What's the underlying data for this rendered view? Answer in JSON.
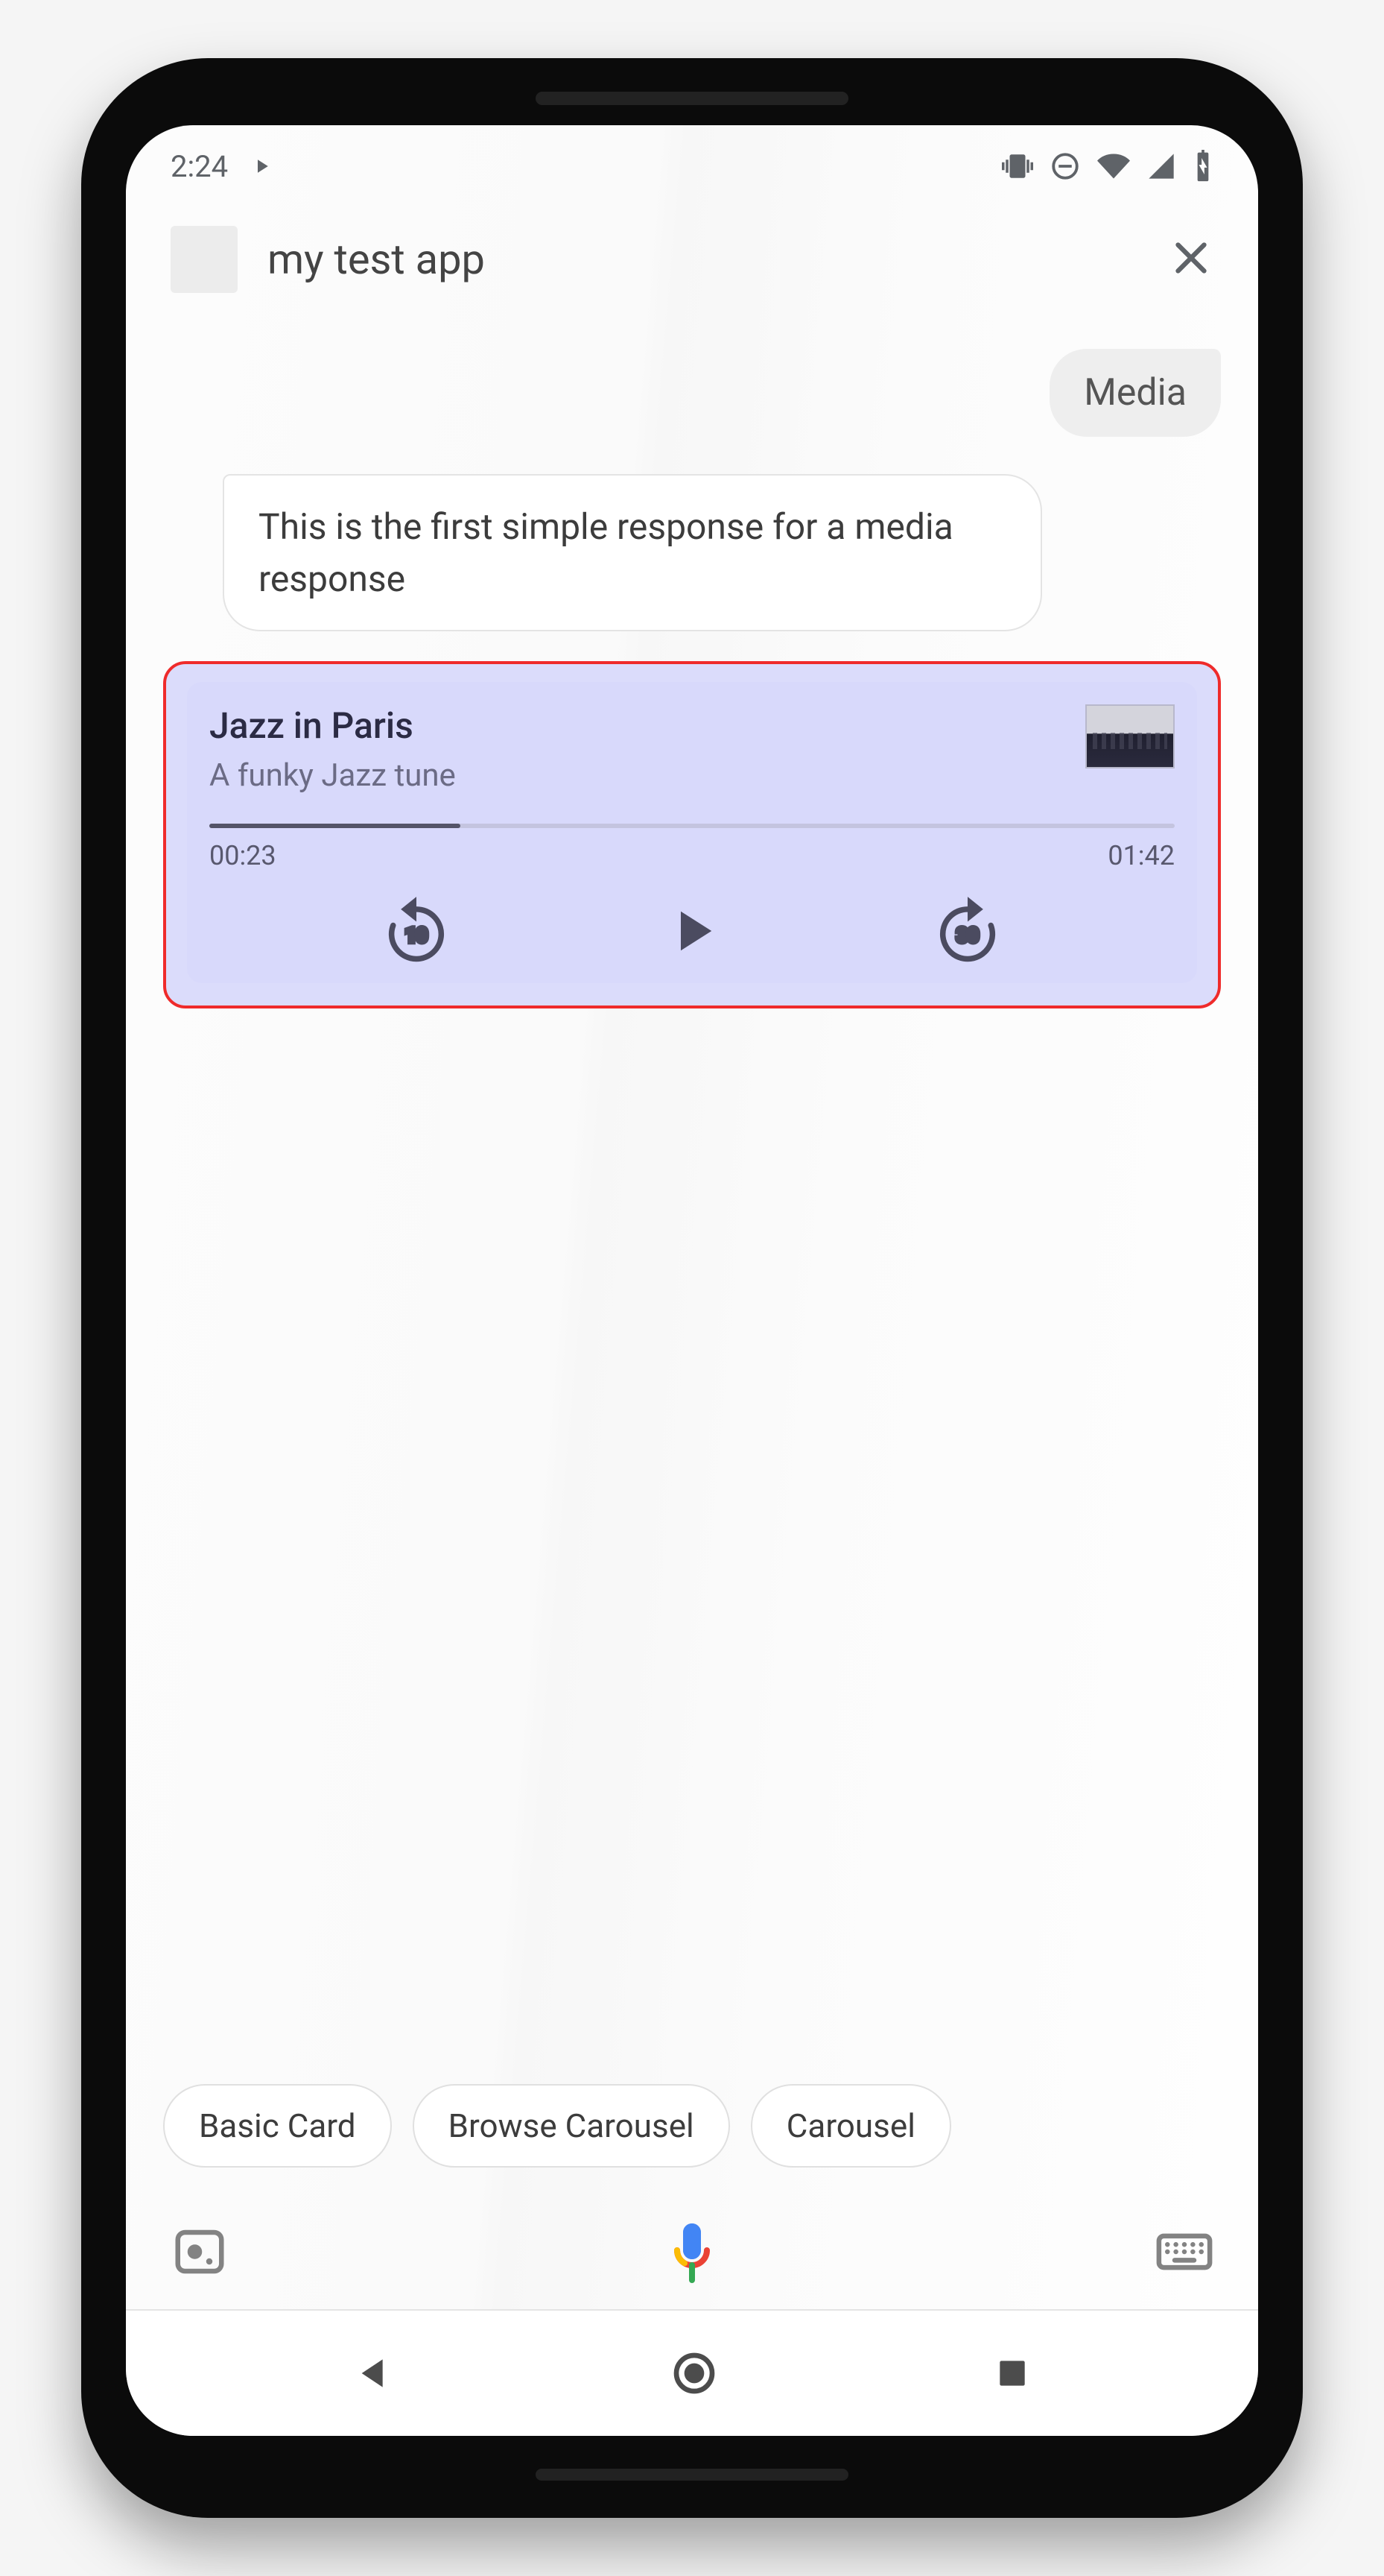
{
  "status": {
    "time": "2:24",
    "playing_icon": "play-small",
    "right_icons": [
      "vibrate",
      "dnd",
      "wifi",
      "cell",
      "battery-charging"
    ]
  },
  "header": {
    "app_title": "my test app"
  },
  "conversation": {
    "user_message": "Media",
    "assistant_message": "This is the first simple response for a media response"
  },
  "media_card": {
    "title": "Jazz in Paris",
    "subtitle": "A funky Jazz tune",
    "elapsed": "00:23",
    "total": "01:42",
    "progress_percent": 26,
    "rewind_seconds": "10",
    "forward_seconds": "30"
  },
  "chips": [
    "Basic Card",
    "Browse Carousel",
    "Carousel"
  ]
}
